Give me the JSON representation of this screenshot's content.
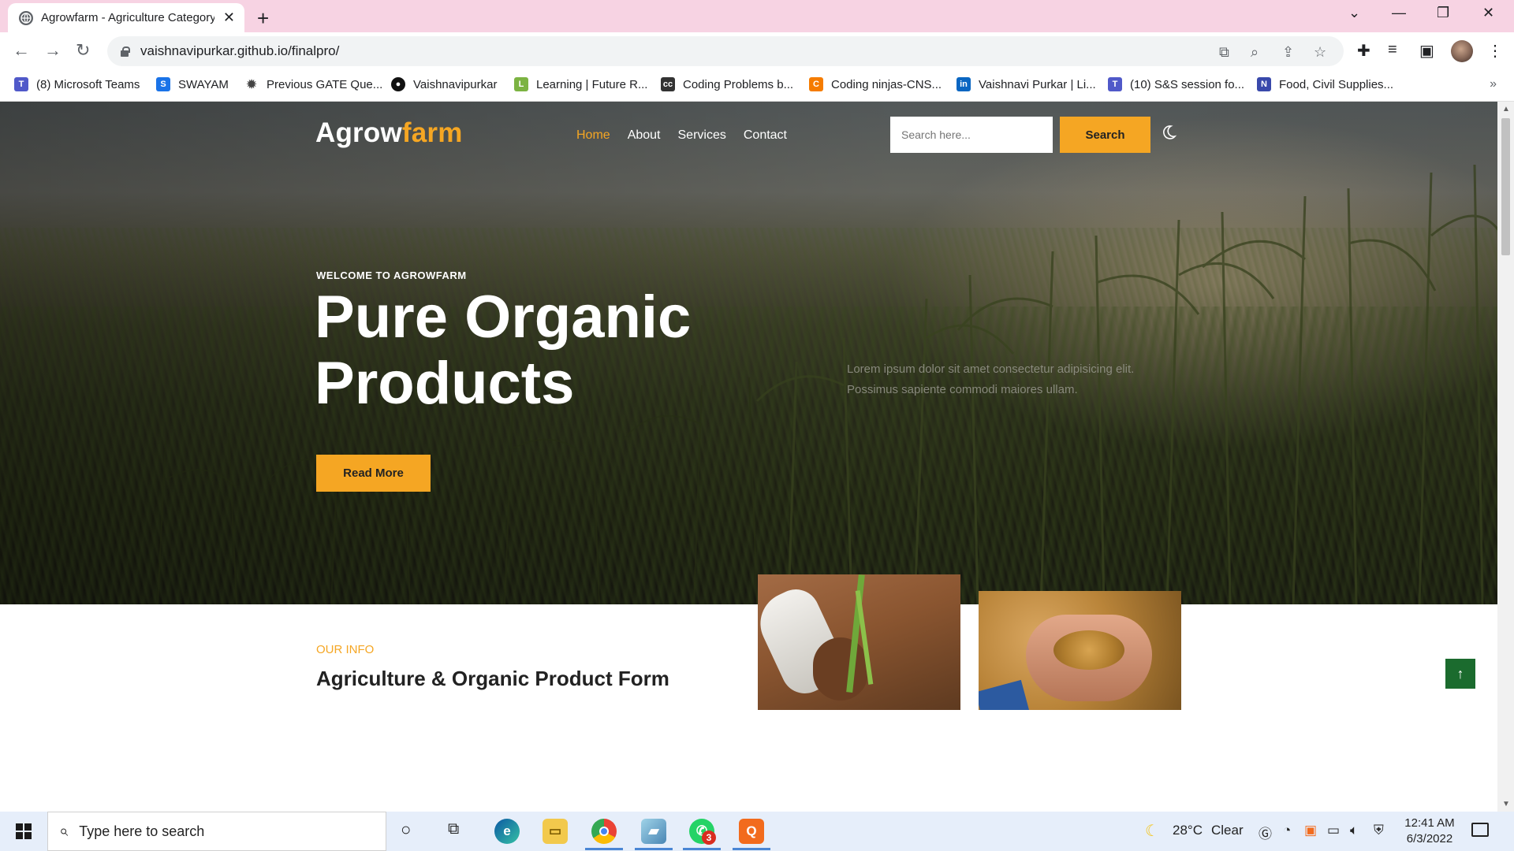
{
  "browser": {
    "tab_title": "Agrowfarm - Agriculture Category",
    "new_tab_label": "+",
    "url": "vaishnavipurkar.github.io/finalpro/",
    "bookmarks": [
      {
        "label": "(8) Microsoft Teams",
        "color": "#5059c9",
        "icon": "teams-icon"
      },
      {
        "label": "SWAYAM",
        "color": "#1a73e8",
        "icon": "swayam-icon"
      },
      {
        "label": "Previous GATE Que...",
        "color": "#444444",
        "icon": "gear-icon"
      },
      {
        "label": "Vaishnavipurkar",
        "color": "#111111",
        "icon": "github-icon"
      },
      {
        "label": "Learning | Future R...",
        "color": "#7cb342",
        "icon": "learning-icon"
      },
      {
        "label": "Coding Problems b...",
        "color": "#333333",
        "icon": "codechef-icon"
      },
      {
        "label": "Coding ninjas-CNS...",
        "color": "#f57c00",
        "icon": "codingninjas-icon"
      },
      {
        "label": "Vaishnavi Purkar | Li...",
        "color": "#0a66c2",
        "icon": "linkedin-icon"
      },
      {
        "label": "(10) S&S session fo...",
        "color": "#5059c9",
        "icon": "teams-icon"
      },
      {
        "label": "Food, Civil Supplies...",
        "color": "#3949ab",
        "icon": "nic-icon"
      }
    ],
    "bookmarks_more": "»"
  },
  "site": {
    "logo_main": "Agrow",
    "logo_accent": "farm",
    "nav": [
      {
        "label": "Home",
        "active": true
      },
      {
        "label": "About",
        "active": false
      },
      {
        "label": "Services",
        "active": false
      },
      {
        "label": "Contact",
        "active": false
      }
    ],
    "search_placeholder": "Search here...",
    "search_button": "Search",
    "hero": {
      "eyebrow": "WELCOME TO AGROWFARM",
      "headline": "Pure Organic Products",
      "lorem": "Lorem ipsum dolor sit amet consectetur adipisicing elit. Possimus sapiente commodi maiores ullam.",
      "cta": "Read More"
    },
    "info": {
      "label": "OUR INFO",
      "title": "Agriculture & Organic Product Form"
    },
    "back_to_top": "↑",
    "accent_color": "#f5a623",
    "to_top_color": "#1b6b2e"
  },
  "taskbar": {
    "search_placeholder": "Type here to search",
    "weather_temp": "28°C",
    "weather_text": "Clear",
    "time": "12:41 AM",
    "date": "6/3/2022",
    "whatsapp_badge": "3"
  }
}
